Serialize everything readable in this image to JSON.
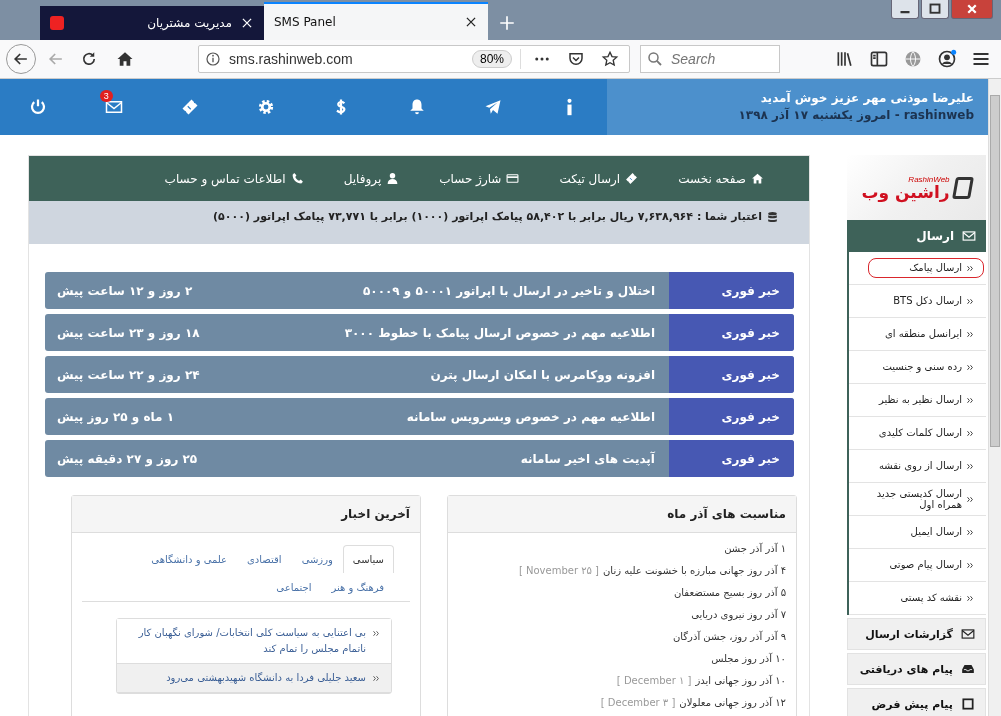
{
  "browser": {
    "tabs": [
      {
        "title": "SMS Panel",
        "selected": true
      },
      {
        "title": "مدیریت مشتریان",
        "selected": false
      }
    ],
    "url": "sms.rashinweb.com",
    "zoom": "80%",
    "search": {
      "placeholder": "Search"
    }
  },
  "header": {
    "welcome": "علیرضا موذنی مهر عزیز خوش آمدید",
    "date_line": "rashinweb - امروز یکشنبه ۱۷ آذر ۱۳۹۸",
    "icons": [
      {
        "kind": "info"
      },
      {
        "kind": "telegram"
      },
      {
        "kind": "bell"
      },
      {
        "kind": "dollar"
      },
      {
        "kind": "gear"
      },
      {
        "kind": "ticket"
      },
      {
        "kind": "mail",
        "badge": "3"
      },
      {
        "kind": "power"
      }
    ]
  },
  "nav": [
    {
      "kind": "home",
      "label": "صفحه نخست"
    },
    {
      "kind": "ticket",
      "label": "ارسال تیکت"
    },
    {
      "kind": "card",
      "label": "شارژ حساب"
    },
    {
      "kind": "user",
      "label": "پروفایل"
    },
    {
      "kind": "phone",
      "label": "اطلاعات تماس و حساب"
    }
  ],
  "credit": "اعتبار شما : ۷,۶۳۸,۹۶۴ ریال برابر با ۵۸,۴۰۲ پیامک اپراتور (۱۰۰۰) برابر با ۷۳,۷۷۱ پیامک اپراتور (۵۰۰۰)",
  "news_ticker": [
    {
      "label": "خبر فوری",
      "title": "اختلال و تاخیر در ارسال با اپراتور ۵۰۰۰۱ و ۵۰۰۰۹",
      "time": "۲ روز و ۱۲ ساعت پیش"
    },
    {
      "label": "خبر فوری",
      "title": "اطلاعیه مهم در خصوص ارسال پیامک با خطوط ۳۰۰۰",
      "time": "۱۸ روز و ۲۳ ساعت پیش"
    },
    {
      "label": "خبر فوری",
      "title": "افزونه ووکامرس با امکان ارسال پترن",
      "time": "۲۴ روز و ۲۲ ساعت پیش"
    },
    {
      "label": "خبر فوری",
      "title": "اطلاعیه مهم در خصوص وبسرویس سامانه",
      "time": "۱ ماه و ۲۵ روز پیش"
    },
    {
      "label": "خبر فوری",
      "title": "آپدیت های اخیر سامانه",
      "time": "۲۵ روز و ۲۷ دقیقه پیش"
    }
  ],
  "occasions": {
    "title": "مناسبت های آذر ماه",
    "items": [
      {
        "text": "۱ آذر آذر جشن"
      },
      {
        "text": "۴ آذر روز جهانی مبارزه با خشونت علیه زنان",
        "note": "[ November ۲۵ ]"
      },
      {
        "text": "۵ آذر روز بسیج مستضعفان"
      },
      {
        "text": "۷ آذر روز نیروی دریایی"
      },
      {
        "text": "۹ آذر آذر روز، جشن آذرگان"
      },
      {
        "text": "۱۰ آذر روز مجلس"
      },
      {
        "text": "۱۰ آذر روز جهانی ایدز",
        "note": "[ December ۱ ]"
      },
      {
        "text": "۱۲ آذر روز جهانی معلولان",
        "note": "[ December ۳ ]"
      }
    ]
  },
  "latest_news": {
    "title": "آخرین اخبار",
    "tabs": [
      {
        "label": "سیاسی",
        "selected": true
      },
      {
        "label": "ورزشی",
        "selected": false
      },
      {
        "label": "اقتصادی",
        "selected": false
      },
      {
        "label": "علمی و دانشگاهی",
        "selected": false
      },
      {
        "label": "فرهنگ و هنر",
        "selected": false
      },
      {
        "label": "اجتماعی",
        "selected": false
      }
    ],
    "items": [
      {
        "text": "بی اعتنایی به سیاست کلی انتخابات/ شورای نگهبان کار ناتمام مجلس را تمام کند",
        "selected": false
      },
      {
        "text": "سعید جلیلی فردا به دانشگاه شهیدبهشتی می‌رود",
        "selected": true
      }
    ]
  },
  "sidebar": {
    "logo": {
      "small": "RashinWeb",
      "name": "راشین وب"
    },
    "section": {
      "title": "ارسال",
      "expanded": true
    },
    "items": [
      {
        "label": "ارسال پیامک",
        "selected": true
      },
      {
        "label": "ارسال دکل BTS",
        "selected": false
      },
      {
        "label": "ایرانسل منطقه ای",
        "selected": false
      },
      {
        "label": "رده سنی و جنسیت",
        "selected": false
      },
      {
        "label": "ارسال نظیر به نظیر",
        "selected": false
      },
      {
        "label": "ارسال کلمات کلیدی",
        "selected": false
      },
      {
        "label": "ارسال از روی نقشه",
        "selected": false
      },
      {
        "label": "ارسال کدپستی جدید همراه اول",
        "selected": false
      },
      {
        "label": "ارسال ایمیل",
        "selected": false
      },
      {
        "label": "ارسال پیام صوتی",
        "selected": false
      },
      {
        "label": "نقشه کد پستی",
        "selected": false
      }
    ],
    "groups": [
      {
        "kind": "mail",
        "title": "گزارشات ارسال"
      },
      {
        "kind": "inbox",
        "title": "پیام های دریافتی"
      },
      {
        "kind": "square",
        "title": "پیام پیش فرض"
      }
    ]
  }
}
